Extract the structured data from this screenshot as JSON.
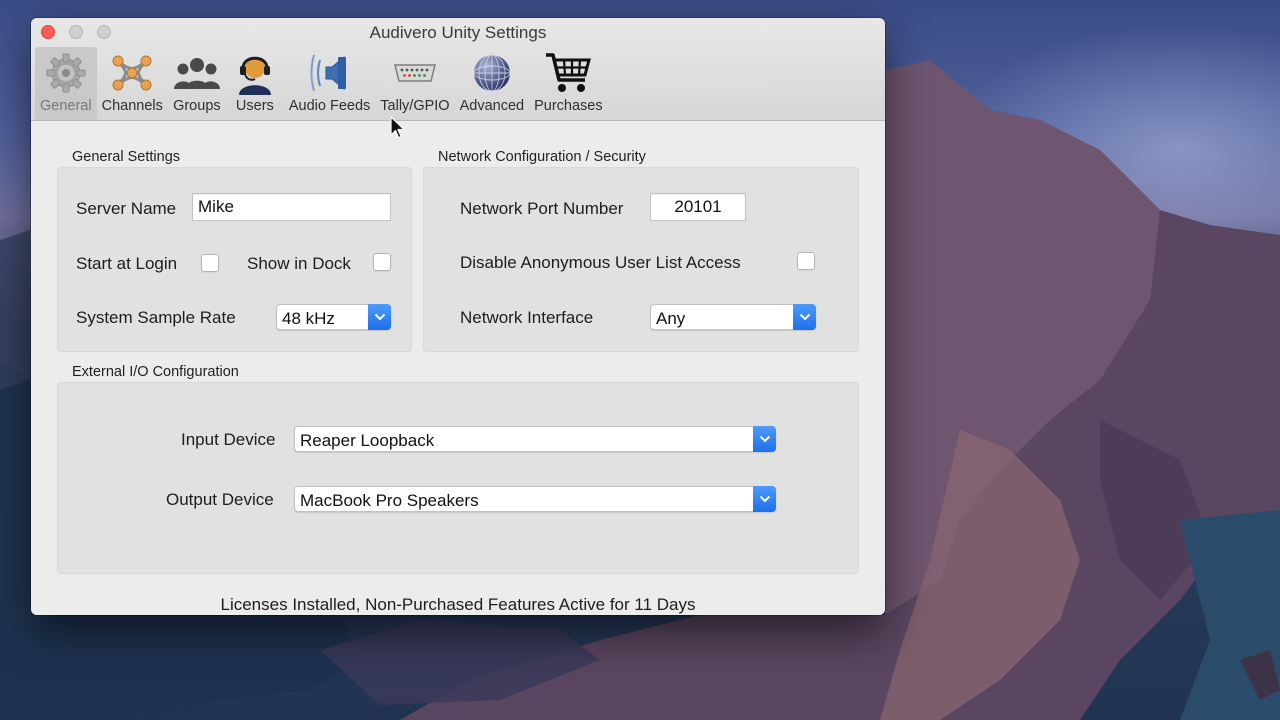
{
  "window": {
    "title": "Audivero Unity Settings"
  },
  "toolbar": {
    "items": [
      {
        "label": "General",
        "icon": "gear-icon",
        "selected": true
      },
      {
        "label": "Channels",
        "icon": "channels-icon",
        "selected": false
      },
      {
        "label": "Groups",
        "icon": "groups-icon",
        "selected": false
      },
      {
        "label": "Users",
        "icon": "headset-user-icon",
        "selected": false
      },
      {
        "label": "Audio Feeds",
        "icon": "speaker-icon",
        "selected": false
      },
      {
        "label": "Tally/GPIO",
        "icon": "connector-icon",
        "selected": false
      },
      {
        "label": "Advanced",
        "icon": "globe-icon",
        "selected": false
      },
      {
        "label": "Purchases",
        "icon": "cart-icon",
        "selected": false
      }
    ]
  },
  "general": {
    "title": "General Settings",
    "server_name_label": "Server Name",
    "server_name_value": "Mike",
    "start_login_label": "Start at Login",
    "show_dock_label": "Show in Dock",
    "sample_rate_label": "System Sample Rate",
    "sample_rate_value": "48 kHz"
  },
  "network": {
    "title": "Network Configuration / Security",
    "port_label": "Network Port Number",
    "port_value": "20101",
    "anon_label": "Disable Anonymous User List Access",
    "interface_label": "Network Interface",
    "interface_value": "Any"
  },
  "io": {
    "title": "External I/O Configuration",
    "input_label": "Input Device",
    "input_value": "Reaper Loopback",
    "output_label": "Output Device",
    "output_value": "MacBook Pro Speakers"
  },
  "status": "Licenses Installed, Non-Purchased Features Active for 11 Days",
  "colors": {
    "accent": "#1f6fea",
    "close": "#fd5b55",
    "window_bg": "#ececec"
  }
}
